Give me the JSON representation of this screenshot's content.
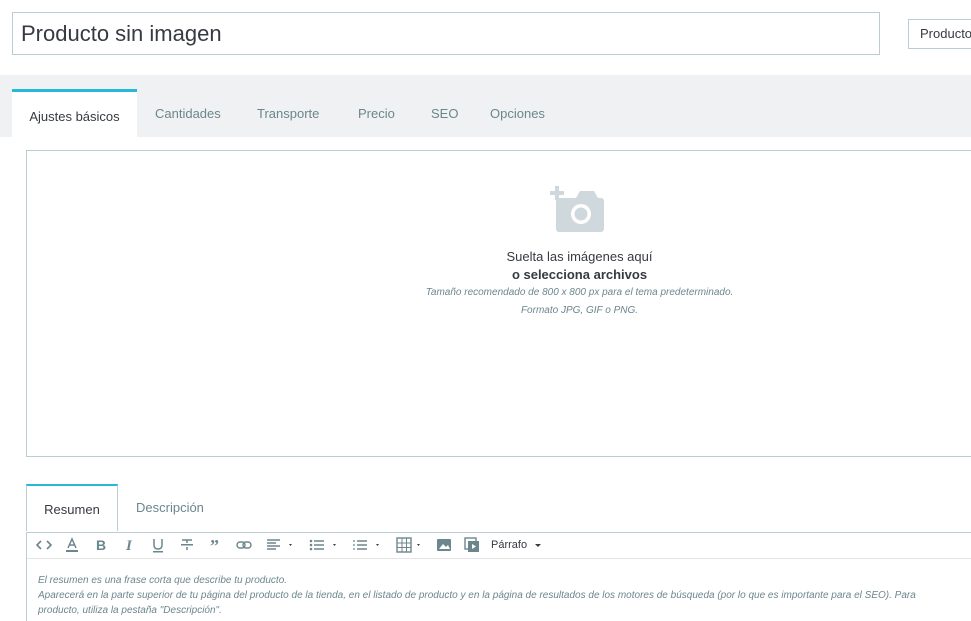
{
  "header": {
    "product_name": "Producto sin imagen",
    "product_type": "Producto"
  },
  "tabs": [
    {
      "label": "Ajustes básicos",
      "active": true
    },
    {
      "label": "Cantidades"
    },
    {
      "label": "Transporte"
    },
    {
      "label": "Precio"
    },
    {
      "label": "SEO"
    },
    {
      "label": "Opciones"
    }
  ],
  "dropzone": {
    "line1": "Suelta las imágenes aquí",
    "line2": "o selecciona archivos",
    "line3": "Tamaño recomendado de 800 x 800 px para el tema predeterminado.",
    "line4": "Formato JPG, GIF o PNG.",
    "icon": "add-photo-icon"
  },
  "editor": {
    "tabs": [
      {
        "label": "Resumen",
        "active": true
      },
      {
        "label": "Descripción"
      }
    ],
    "toolbar": {
      "paragraph_label": "Párrafo",
      "icons": [
        "code-icon",
        "font-color-icon",
        "bold-icon",
        "italic-icon",
        "underline-icon",
        "strikethrough-icon",
        "blockquote-icon",
        "link-icon",
        "align-icon",
        "bullet-list-icon",
        "numbered-list-icon",
        "table-icon",
        "image-icon",
        "media-icon"
      ]
    },
    "help_line1": "El resumen es una frase corta que describe tu producto.",
    "help_line2": "Aparecerá en la parte superior de tu página del producto de la tienda, en el listado de producto y en la página de resultados de los motores de búsqueda (por lo que es importante para el SEO). Para",
    "help_line3": "producto, utiliza la pestaña \"Descripción\"."
  },
  "colors": {
    "accent": "#25b9d7",
    "border": "#bbcdd2",
    "strip": "#eff1f2",
    "muted_text": "#6c868e",
    "text": "#363a41"
  }
}
